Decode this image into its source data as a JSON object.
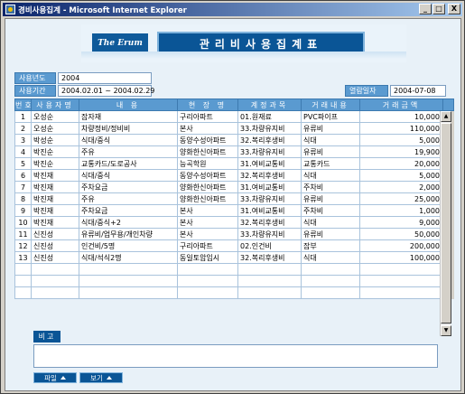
{
  "window": {
    "title": "경비사용집계 - Microsoft Internet Explorer",
    "minimize": "_",
    "maximize": "□",
    "close": "X"
  },
  "banner": {
    "logo": "The Erum",
    "title": "관리비사용집계표"
  },
  "filters": {
    "year_label": "사용년도",
    "year_value": "2004",
    "period_label": "사용기간",
    "period_value": "2004.02.01 ~ 2004.02.29",
    "view_date_label": "열람일자",
    "view_date_value": "2004-07-08"
  },
  "table": {
    "headers": [
      "번호",
      "사용자명",
      "내 용",
      "현 장 명",
      "계정과목",
      "거래내용",
      "거래금액"
    ],
    "rows": [
      [
        "1",
        "오성순",
        "잡자재",
        "구리아파트",
        "01.원재료",
        "PVC파이프",
        "10,000"
      ],
      [
        "2",
        "오성순",
        "차량정비/정비비",
        "본사",
        "33.차량유지비",
        "유류비",
        "110,000"
      ],
      [
        "3",
        "박성순",
        "식대/중식",
        "동양수성아파트",
        "32.복리후생비",
        "식대",
        "5,000"
      ],
      [
        "4",
        "박진순",
        "주유",
        "양화한신아파트",
        "33.차량유지비",
        "유류비",
        "19,900"
      ],
      [
        "5",
        "박진순",
        "교통카드/도로공사",
        "능곡학원",
        "31.여비교통비",
        "교통카드",
        "20,000"
      ],
      [
        "6",
        "박진재",
        "식대/중식",
        "동양수성아파트",
        "32.복리후생비",
        "식대",
        "5,000"
      ],
      [
        "7",
        "박진재",
        "주차요금",
        "양화한신아파트",
        "31.여비교통비",
        "주차비",
        "2,000"
      ],
      [
        "8",
        "박진재",
        "주유",
        "양화한신아파트",
        "33.차량유지비",
        "유류비",
        "25,000"
      ],
      [
        "9",
        "박진재",
        "주차요금",
        "본사",
        "31.여비교통비",
        "주차비",
        "1,000"
      ],
      [
        "10",
        "박진재",
        "식대/중식+2",
        "본사",
        "32.복리후생비",
        "식대",
        "9,000"
      ],
      [
        "11",
        "신진성",
        "유류비/업무용/개인차량",
        "본사",
        "33.차량유지비",
        "유류비",
        "50,000"
      ],
      [
        "12",
        "신진성",
        "인건비/5명",
        "구리아파트",
        "02.인건비",
        "잡부",
        "200,000"
      ],
      [
        "13",
        "신진성",
        "식대/석식2명",
        "동일토암임시",
        "32.복리후생비",
        "식대",
        "100,000"
      ]
    ],
    "empty_rows": 3
  },
  "remarks": {
    "label": "비고",
    "value": ""
  },
  "buttons": {
    "file": "파일",
    "view": "보기"
  }
}
